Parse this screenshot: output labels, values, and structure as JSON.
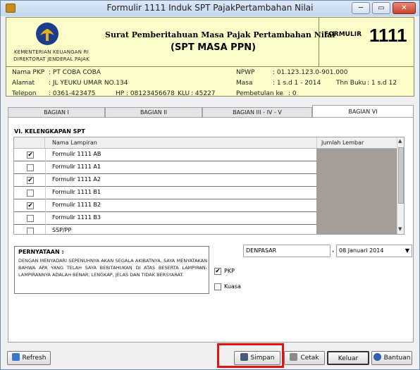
{
  "window": {
    "title": "Formulir 1111 Induk SPT PajakPertambahan Nilai",
    "minimize": "─",
    "maximize": "▭",
    "close": "✕"
  },
  "header": {
    "org_line1": "KEMENTERIAN KEUANGAN RI",
    "org_line2": "DIREKTORAT JENDERAL PAJAK",
    "title": "Surat Pemberitahuan Masa Pajak Pertambahan Nilai",
    "subtitle": "(SPT MASA PPN)",
    "form_label": "FORMULIR",
    "form_number": "1111"
  },
  "info": {
    "nama_label": "Nama PKP",
    "nama_value": ": PT COBA COBA",
    "alamat_label": "Alamat",
    "alamat_value": ": JL YEUKU UMAR NO.134",
    "telepon_label": "Telepon",
    "telepon_value": ": 0361-423475",
    "hp_label": "HP",
    "hp_value": ": 08123456678",
    "kll_label": "KLU",
    "kll_value": ": 45227",
    "npwp_label": "NPWP",
    "npwp_value": ": 01.123.123.0-901.000",
    "masa_label": "Masa",
    "masa_value": ": 1 s.d 1 - 2014",
    "tahun_label": "Thn Buku",
    "tahun_value": ": 1 s.d 12",
    "pembetulan_label": "Pembetulan ke",
    "pembetulan_value": ": 0"
  },
  "tabs": [
    {
      "label": "BAGIAN I"
    },
    {
      "label": "BAGIAN II"
    },
    {
      "label": "BAGIAN III - IV - V"
    },
    {
      "label": "BAGIAN VI"
    }
  ],
  "section": {
    "title": "VI. KELENGKAPAN SPT",
    "col_name": "Nama Lampiran",
    "col_count": "Jumlah Lembar",
    "rows": [
      {
        "name": "Formulir 1111 AB",
        "checked": "✔"
      },
      {
        "name": "Formulir 1111 A1",
        "checked": ""
      },
      {
        "name": "Formulir 1111 A2",
        "checked": "✔"
      },
      {
        "name": "Formulir 1111 B1",
        "checked": ""
      },
      {
        "name": "Formulir 1111 B2",
        "checked": "✔"
      },
      {
        "name": "Formulir 1111 B3",
        "checked": ""
      },
      {
        "name": "SSP/PP",
        "checked": ""
      }
    ]
  },
  "statement": {
    "title": "PERNYATAAN :",
    "body": "DENGAN MENYADARI SEPENUHNYA AKAN SEGALA AKIBATNYA, SAYA MENYATAKAN BAHWA APA YANG TELAH SAYA BERITAHUKAN DI ATAS BESERTA LAMPIRAN-LAMPIRANNYA ADALAH BENAR, LENGKAP, JELAS DAN TIDAK BERSYARAT."
  },
  "signing": {
    "city": "DENPASAR",
    "comma": ",",
    "date": "08  Januari  2014",
    "pkp_label": "PKP",
    "pkp_checked": "✔",
    "kuasa_label": "Kuasa",
    "kuasa_checked": ""
  },
  "buttons": {
    "refresh": "Refresh",
    "simpan": "Simpan",
    "cetak": "Cetak",
    "keluar": "Keluar",
    "bantuan": "Bantuan"
  }
}
